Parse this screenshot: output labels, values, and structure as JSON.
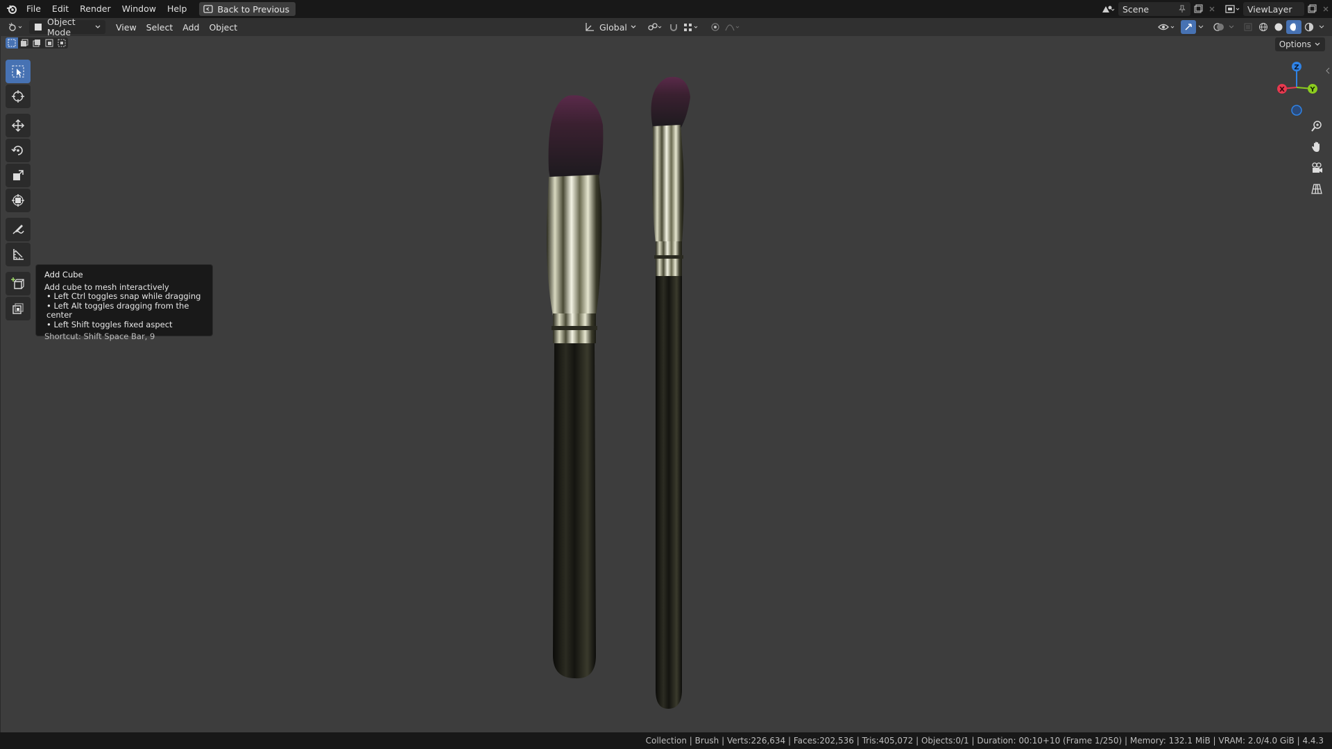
{
  "top_menu": {
    "items": [
      "File",
      "Edit",
      "Render",
      "Window",
      "Help"
    ],
    "back_button": "Back to Previous",
    "scene_name": "Scene",
    "view_layer": "ViewLayer"
  },
  "header": {
    "mode": "Object Mode",
    "menus": [
      "View",
      "Select",
      "Add",
      "Object"
    ],
    "orientation": "Global",
    "options_label": "Options"
  },
  "tooltip": {
    "title": "Add Cube",
    "description": "Add cube to mesh interactively",
    "bullets": [
      "• Left Ctrl toggles snap while dragging",
      "• Left Alt toggles dragging from the center",
      "• Left Shift toggles fixed aspect"
    ],
    "shortcut": "Shortcut: Shift Space Bar, 9"
  },
  "gizmo": {
    "z": "Z",
    "y": "Y",
    "x": "X"
  },
  "status_bar": "Collection | Brush | Verts:226,634 | Faces:202,536 | Tris:405,072 | Objects:0/1 | Duration: 00:10+10 (Frame 1/250) | Memory: 132.1 MiB | VRAM: 2.0/4.0 GiB | 4.4.3",
  "colors": {
    "accent": "#4772b3",
    "viewport": "#3d3d3d",
    "axis_x": "#e8394f",
    "axis_y": "#8ccd1f",
    "axis_z": "#2f83e6"
  }
}
